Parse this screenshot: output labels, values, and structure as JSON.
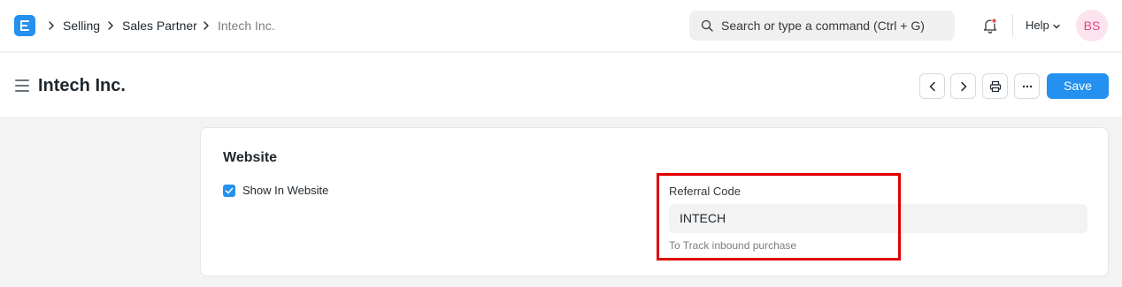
{
  "navbar": {
    "breadcrumbs": [
      "Selling",
      "Sales Partner",
      "Intech Inc."
    ],
    "search_placeholder": "Search or type a command (Ctrl + G)",
    "help_label": "Help",
    "avatar_initials": "BS"
  },
  "page": {
    "title": "Intech Inc.",
    "save_label": "Save"
  },
  "section": {
    "title": "Website",
    "show_in_website": {
      "label": "Show In Website",
      "checked": true
    },
    "referral_code": {
      "label": "Referral Code",
      "value": "INTECH",
      "help_text": "To Track inbound purchase"
    }
  },
  "colors": {
    "primary": "#2490ef",
    "highlight": "#e00000",
    "avatar_bg": "#fce4ee",
    "avatar_text": "#e0447a"
  }
}
